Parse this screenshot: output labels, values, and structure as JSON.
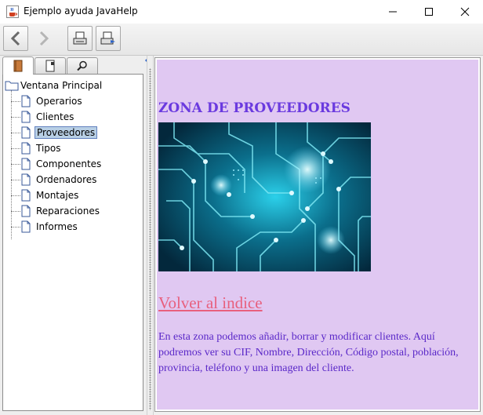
{
  "window": {
    "title": "Ejemplo ayuda JavaHelp",
    "icon": "java-cup-icon",
    "controls": [
      "minimize-icon",
      "maximize-icon",
      "close-icon"
    ]
  },
  "toolbar": {
    "buttons": [
      "back-arrow-icon",
      "forward-arrow-icon",
      "print-icon",
      "page-setup-icon"
    ]
  },
  "navigator": {
    "tabs": [
      "toc-book-icon",
      "index-icon",
      "search-icon"
    ],
    "active_tab": 0,
    "tree": {
      "root": "Ventana Principal",
      "items": [
        "Operarios",
        "Clientes",
        "Proveedores",
        "Tipos",
        "Componentes",
        "Ordenadores",
        "Montajes",
        "Reparaciones",
        "Informes"
      ],
      "selected": 2
    }
  },
  "content": {
    "heading": "ZONA DE PROVEEDORES",
    "image": "circuit-board-image",
    "link": "Volver al indice",
    "description": "En esta zona podemos añadir, borrar y modificar clientes. Aquí podremos ver su CIF, Nombre, Dirección, Código postal, población, provincia, teléfono y una imagen del cliente.",
    "colors": {
      "background": "#e0c8f2",
      "heading": "#6a3adf",
      "link": "#e8607e",
      "text": "#5a28c8"
    }
  }
}
